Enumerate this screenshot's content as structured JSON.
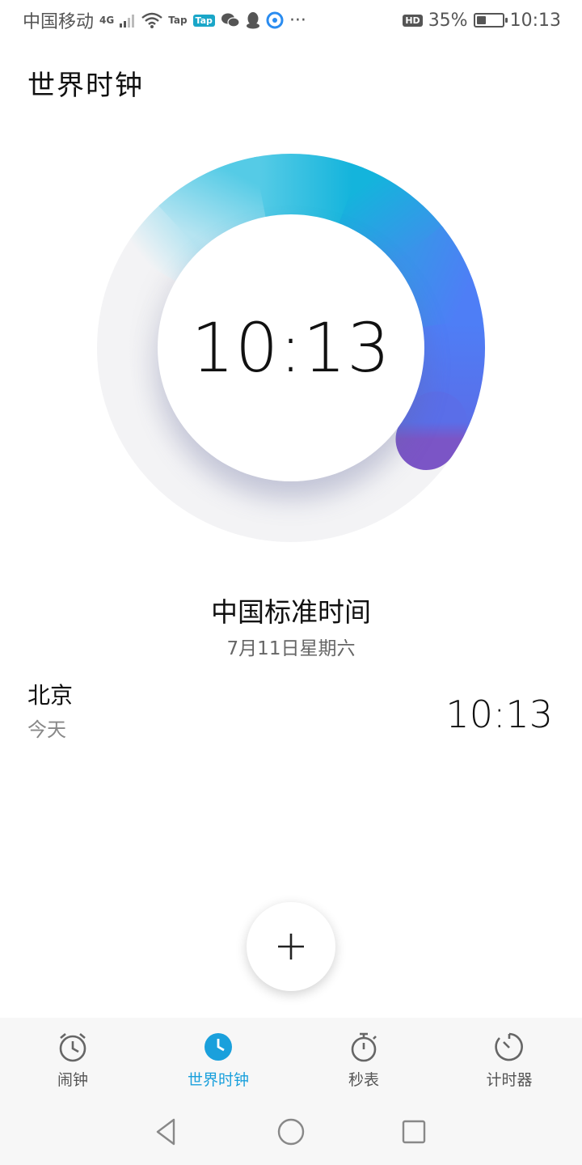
{
  "status_bar": {
    "carrier": "中国移动",
    "network_type": "4G",
    "tap_label": "Tap",
    "tap_tag": "Tap",
    "more": "···",
    "hd_label": "HD",
    "battery": "35%",
    "battery_level": 0.35,
    "time": "10:13"
  },
  "header": {
    "title": "世界时钟"
  },
  "dial": {
    "time": "10:13"
  },
  "zone": {
    "name": "中国标准时间",
    "date": "7月11日星期六"
  },
  "cities": [
    {
      "name": "北京",
      "day": "今天",
      "time": "10:13"
    }
  ],
  "fab": {
    "icon": "plus-icon"
  },
  "tabs": [
    {
      "label": "闹钟",
      "icon": "alarm-clock-icon",
      "active": false
    },
    {
      "label": "世界时钟",
      "icon": "world-clock-icon",
      "active": true
    },
    {
      "label": "秒表",
      "icon": "stopwatch-icon",
      "active": false
    },
    {
      "label": "计时器",
      "icon": "timer-icon",
      "active": false
    }
  ],
  "system_nav": {
    "back_icon": "back-triangle-icon",
    "home_icon": "home-circle-icon",
    "recents_icon": "recents-square-icon"
  },
  "colors": {
    "accent": "#1aa0dc",
    "arc_start": "#9fdff0",
    "arc_mid": "#14b4dc",
    "arc_blue": "#4e7ef6",
    "arc_end": "#7b55c6",
    "track": "#f0f0f2"
  }
}
